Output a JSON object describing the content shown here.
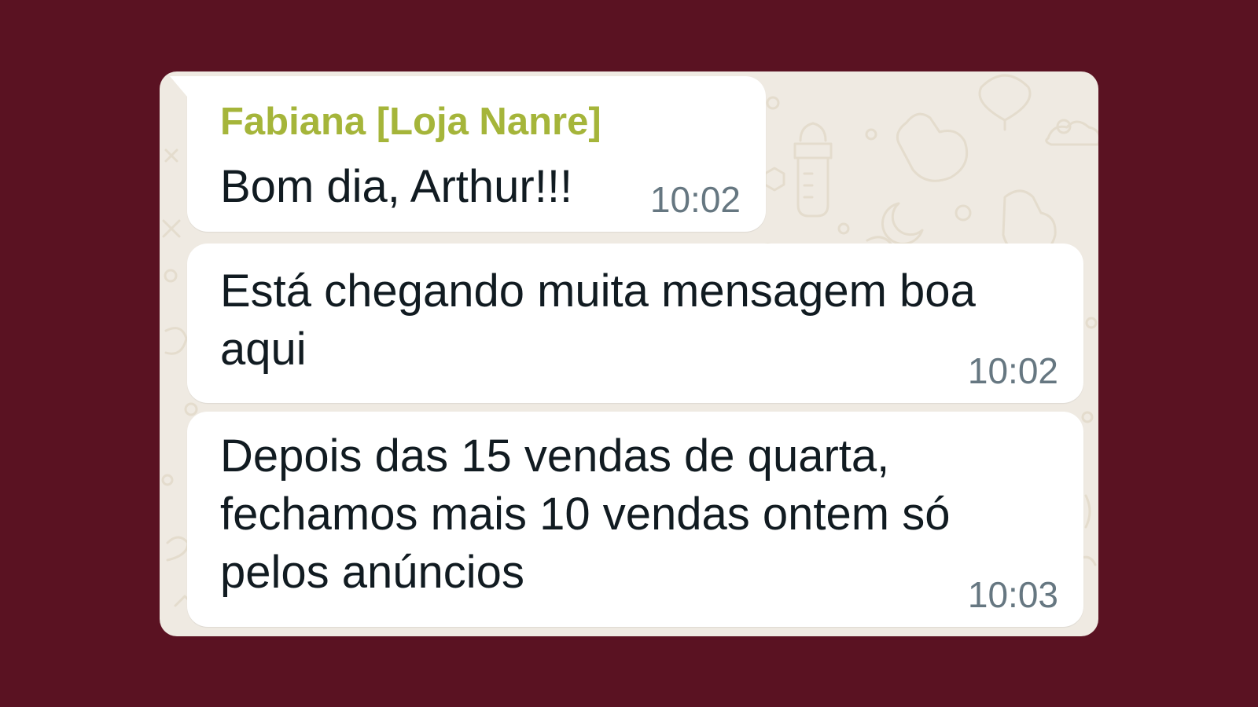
{
  "chat": {
    "colors": {
      "page_background": "#5a1222",
      "chat_wallpaper": "#efeae2",
      "bubble": "#ffffff",
      "sender_name": "#a5b53a",
      "message_text": "#111b21",
      "timestamp": "#667781"
    },
    "messages": [
      {
        "sender": "Fabiana [Loja Nanre]",
        "text": "Bom dia, Arthur!!!",
        "time": "10:02"
      },
      {
        "text": "Está chegando muita mensagem boa\naqui",
        "time": "10:02"
      },
      {
        "text": "Depois das 15 vendas de quarta,\nfechamos mais 10 vendas ontem só\npelos anúncios",
        "time": "10:03"
      }
    ]
  }
}
